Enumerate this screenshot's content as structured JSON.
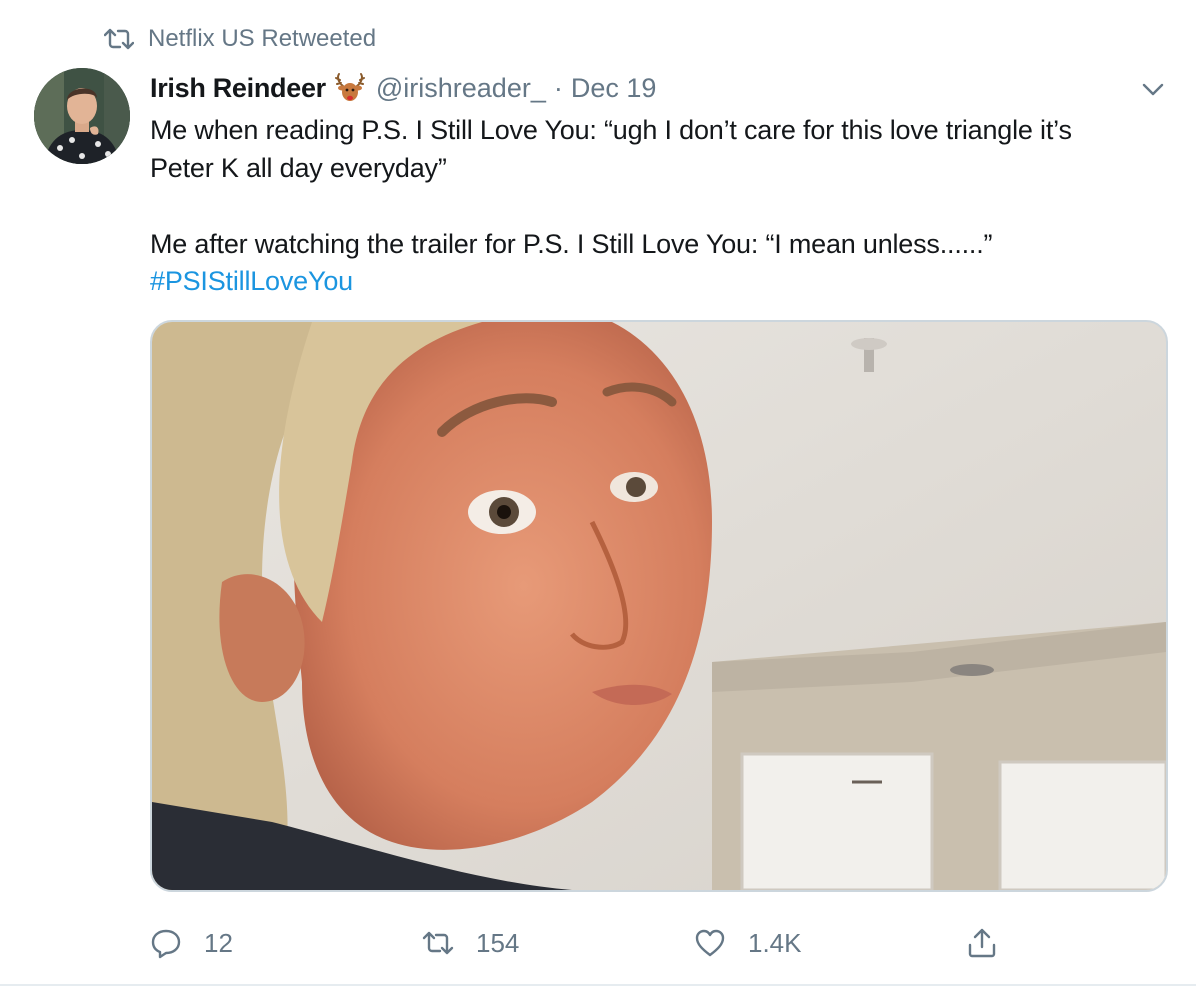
{
  "retweet_banner": {
    "text": "Netflix US Retweeted",
    "icon": "retweet-icon"
  },
  "author": {
    "display_name": "Irish Reindeer",
    "emoji": "deer-emoji",
    "handle": "@irishreader_",
    "separator": "·",
    "date": "Dec 19"
  },
  "tweet": {
    "line1": "Me when reading P.S. I Still Love You: “ugh I don’t care for this love triangle it’s",
    "line2": "Peter K all day everyday”",
    "line3": "Me after watching the trailer for P.S. I Still Love You: “I mean unless......”",
    "hashtag": "#PSIStillLoveYou"
  },
  "actions": {
    "reply_count": "12",
    "retweet_count": "154",
    "like_count": "1.4K"
  },
  "colors": {
    "text": "#14171a",
    "secondary": "#657786",
    "link": "#1b95e0",
    "border": "#ccd6dd"
  }
}
